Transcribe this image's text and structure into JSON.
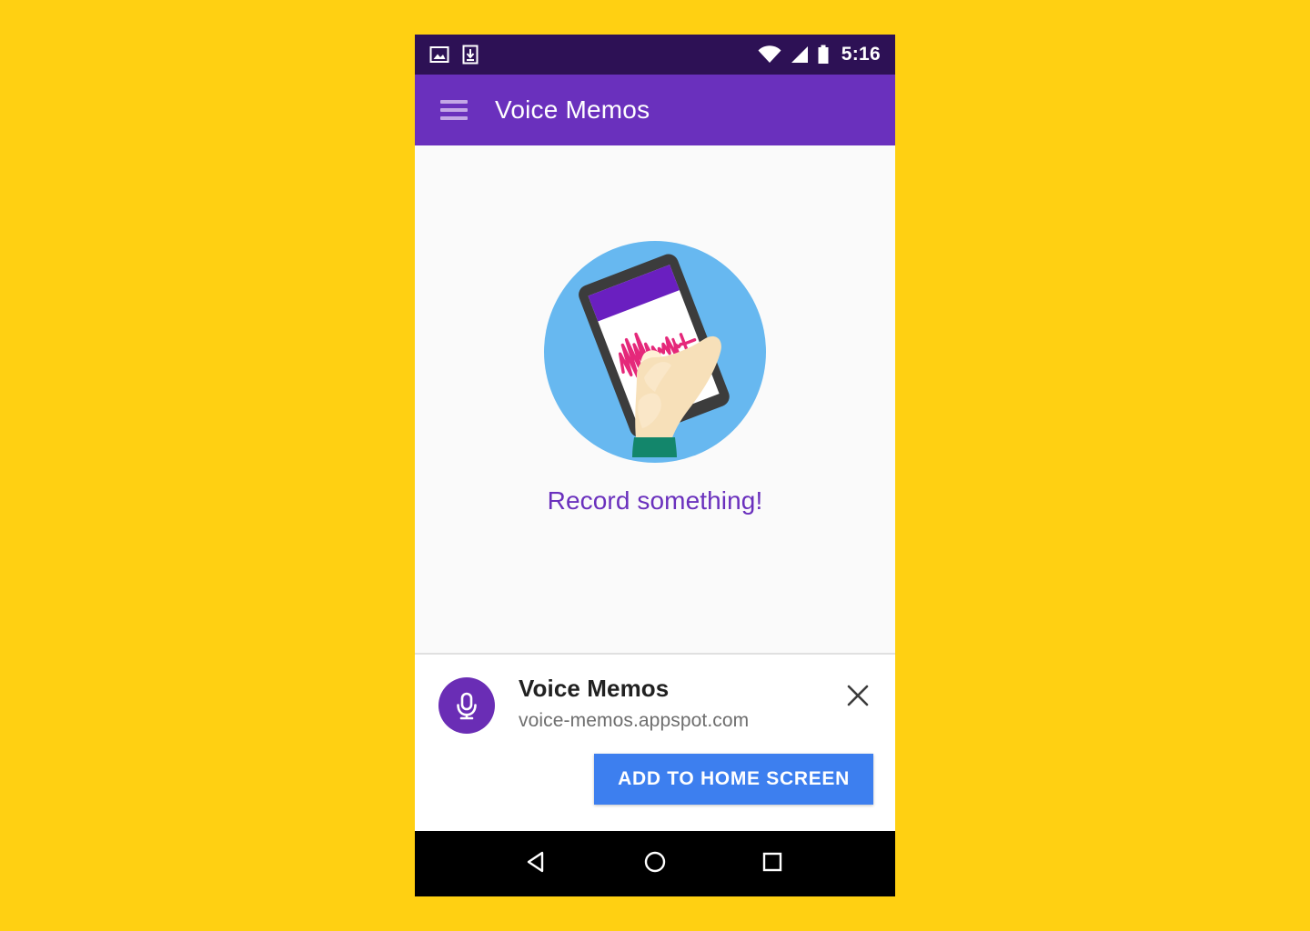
{
  "background_color": "#FFD012",
  "status_bar": {
    "background_color": "#2D1155",
    "time": "5:16",
    "left_icons": [
      "image-icon",
      "download-icon"
    ],
    "right_icons": [
      "wifi-icon",
      "cellular-signal-icon",
      "battery-icon"
    ]
  },
  "app_bar": {
    "background_color": "#6A30BD",
    "menu_icon": "hamburger-menu-icon",
    "title": "Voice Memos"
  },
  "content": {
    "background_color": "#FAFAFA",
    "illustration": {
      "name": "hand-holding-phone-recording-illustration",
      "circle_color": "#67B8F0",
      "phone_body_color": "#3C3C3C",
      "phone_screen_color": "#FFFFFF",
      "phone_appbar_color": "#6A1FC0",
      "waveform_color": "#E5287A",
      "skin_color": "#F7E0B9",
      "sleeve_color": "#13866B"
    },
    "empty_state_label": "Record something!",
    "empty_state_label_color": "#6A30BD"
  },
  "install_banner": {
    "background_color": "#FFFFFF",
    "app_icon": "microphone-icon",
    "app_icon_background_color": "#6A2DB5",
    "app_name": "Voice Memos",
    "app_url": "voice-memos.appspot.com",
    "close_icon": "close-icon",
    "install_button_label": "ADD TO HOME SCREEN",
    "install_button_color": "#3D7FEF"
  },
  "nav_bar": {
    "background_color": "#000000",
    "buttons": [
      {
        "name": "back-button",
        "icon": "back-triangle-icon"
      },
      {
        "name": "home-button",
        "icon": "home-circle-icon"
      },
      {
        "name": "recents-button",
        "icon": "recents-square-icon"
      }
    ]
  }
}
